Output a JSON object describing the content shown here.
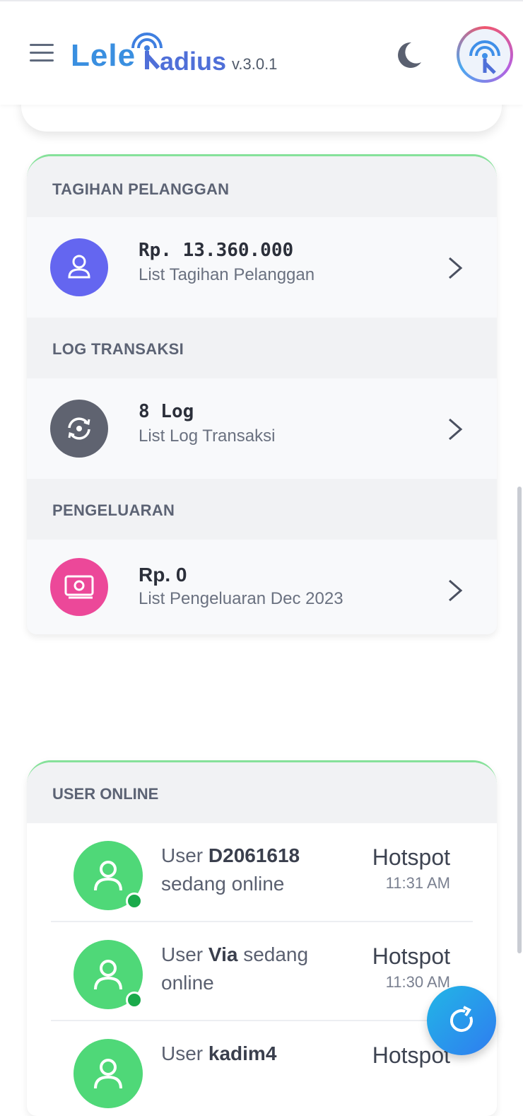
{
  "header": {
    "logo_part1": "Lele",
    "logo_part2": "adius",
    "version": "v.3.0.1",
    "icons": [
      "hamburger-menu-icon",
      "dark-mode-moon-icon",
      "profile-avatar"
    ]
  },
  "sections": [
    {
      "title": "TAGIHAN PELANGGAN",
      "value": "Rp. 13.360.000",
      "label": "List Tagihan Pelanggan",
      "icon": "user-icon",
      "color": "#6466f0"
    },
    {
      "title": "LOG TRANSAKSI",
      "value": "8 Log",
      "label": "List Log Transaksi",
      "icon": "sync-icon",
      "color": "#5f6370"
    },
    {
      "title": "PENGELUARAN",
      "value": "Rp. 0",
      "label": "List Pengeluaran Dec 2023",
      "icon": "money-icon",
      "color": "#ec4899"
    }
  ],
  "online": {
    "title": "USER ONLINE",
    "users": [
      {
        "prefix": "User ",
        "name": "D2061618",
        "suffix": " sedang online",
        "type": "Hotspot",
        "time": "11:31 AM"
      },
      {
        "prefix": "User ",
        "name": "Via",
        "suffix": " sedang online",
        "type": "Hotspot",
        "time": "11:30 AM"
      },
      {
        "prefix": "User ",
        "name": "kadim4",
        "suffix": "",
        "type": "Hotspot",
        "time": ""
      }
    ]
  },
  "colors": {
    "accent": "#3b82f6",
    "online_green": "#4fd878",
    "card_top_border": "#86e19a"
  }
}
